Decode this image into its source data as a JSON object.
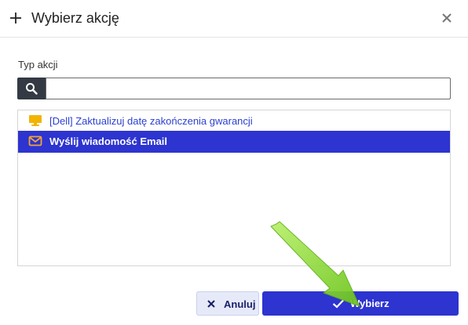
{
  "dialog": {
    "title": "Wybierz akcję"
  },
  "form": {
    "label": "Typ akcji",
    "search_value": "",
    "search_placeholder": ""
  },
  "actions": [
    {
      "label": "[Dell] Zaktualizuj datę zakończenia gwarancji",
      "icon": "monitor-icon",
      "icon_color": "#f2b400",
      "selected": false
    },
    {
      "label": "Wyślij wiadomość Email",
      "icon": "envelope-icon",
      "icon_color": "#f2a33a",
      "selected": true
    }
  ],
  "buttons": {
    "cancel_label": "Anuluj",
    "select_label": "Wybierz"
  },
  "colors": {
    "primary": "#2d34cf",
    "selected_text": "#ffffff",
    "link_text": "#2b3fcf",
    "annotation_arrow": "#7ed321"
  }
}
